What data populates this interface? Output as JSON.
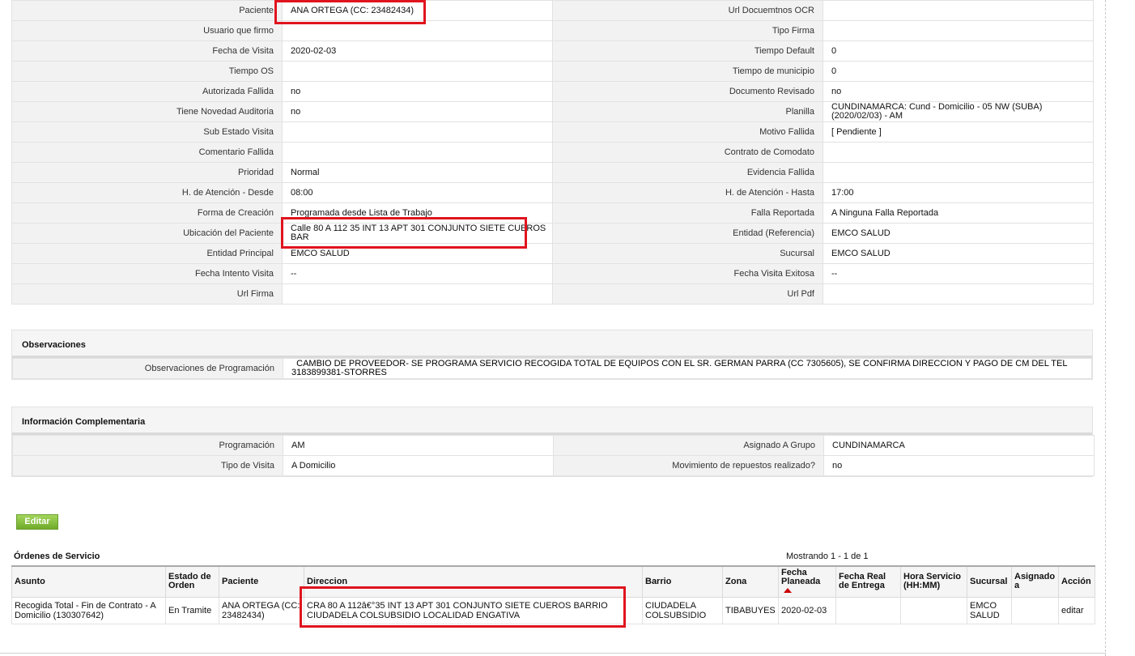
{
  "details": {
    "rows": [
      {
        "l1": "Paciente",
        "v1": "ANA ORTEGA (CC: 23482434)",
        "l2": "Url Docuemtnos OCR",
        "v2": ""
      },
      {
        "l1": "Usuario que firmo",
        "v1": "",
        "l2": "Tipo Firma",
        "v2": ""
      },
      {
        "l1": "Fecha de Visita",
        "v1": "2020-02-03",
        "l2": "Tiempo Default",
        "v2": "0"
      },
      {
        "l1": "Tiempo OS",
        "v1": "",
        "l2": "Tiempo de municipio",
        "v2": "0"
      },
      {
        "l1": "Autorizada Fallida",
        "v1": "no",
        "l2": "Documento Revisado",
        "v2": "no"
      },
      {
        "l1": "Tiene Novedad Auditoria",
        "v1": "no",
        "l2": "Planilla",
        "v2": "CUNDINAMARCA: Cund - Domicilio - 05 NW (SUBA) (2020/02/03) - AM"
      },
      {
        "l1": "Sub Estado Visita",
        "v1": "",
        "l2": "Motivo Fallida",
        "v2": "[ Pendiente ]"
      },
      {
        "l1": "Comentario Fallida",
        "v1": "",
        "l2": "Contrato de Comodato",
        "v2": ""
      },
      {
        "l1": "Prioridad",
        "v1": "Normal",
        "l2": "Evidencia Fallida",
        "v2": ""
      },
      {
        "l1": "H. de Atención - Desde",
        "v1": "08:00",
        "l2": "H. de Atención - Hasta",
        "v2": "17:00"
      },
      {
        "l1": "Forma de Creación",
        "v1": "Programada desde Lista de Trabajo",
        "l2": "Falla Reportada",
        "v2": "A Ninguna Falla Reportada"
      },
      {
        "l1": "Ubicación del Paciente",
        "v1": "Calle 80 A 112 35 INT 13 APT 301 CONJUNTO SIETE CUEROS BAR",
        "l2": "Entidad (Referencia)",
        "v2": "EMCO SALUD"
      },
      {
        "l1": "Entidad Principal",
        "v1": "EMCO SALUD",
        "l2": "Sucursal",
        "v2": "EMCO SALUD"
      },
      {
        "l1": "Fecha Intento Visita",
        "v1": "--",
        "l2": "Fecha Visita Exitosa",
        "v2": "--"
      },
      {
        "l1": "Url Firma",
        "v1": "",
        "l2": "Url Pdf",
        "v2": ""
      }
    ]
  },
  "observaciones": {
    "title": "Observaciones",
    "label": "Observaciones de Programación",
    "value": "  CAMBIO DE PROVEEDOR- SE PROGRAMA SERVICIO RECOGIDA TOTAL DE EQUIPOS CON EL SR. GERMAN PARRA (CC 7305605), SE CONFIRMA DIRECCION Y PAGO DE CM DEL TEL 3183899381-STORRES"
  },
  "complementaria": {
    "title": "Información Complementaria",
    "rows": [
      {
        "l1": "Programación",
        "v1": "AM",
        "l2": "Asignado A Grupo",
        "v2": "CUNDINAMARCA"
      },
      {
        "l1": "Tipo de Visita",
        "v1": "A Domicilio",
        "l2": "Movimiento de repuestos realizado?",
        "v2": "no"
      }
    ]
  },
  "editar_label": "Editar",
  "orders": {
    "title": "Órdenes de Servicio",
    "count_text": "Mostrando 1 - 1 de 1",
    "headers": [
      "Asunto",
      "Estado de Orden",
      "Paciente",
      "Direccion",
      "Barrio",
      "Zona",
      "Fecha Planeada",
      "Fecha Real de Entrega",
      "Hora Servicio (HH:MM)",
      "Sucursal",
      "Asignado a",
      "Acción"
    ],
    "rows": [
      {
        "asunto": "Recogida Total - Fin de Contrato - A Domicilio (130307642)",
        "estado": "En Tramite",
        "paciente": "ANA ORTEGA (CC: 23482434)",
        "direccion": "CRA 80 A 112â€°35 INT 13 APT 301 CONJUNTO SIETE CUEROS BARRIO CIUDADELA COLSUBSIDIO LOCALIDAD ENGATIVA",
        "barrio": "CIUDADELA COLSUBSIDIO",
        "zona": "TIBABUYES",
        "fecha_planeada": "2020-02-03",
        "fecha_real": "",
        "hora": "",
        "sucursal": "EMCO SALUD",
        "asignado": "",
        "accion": "editar"
      }
    ]
  },
  "colors": {
    "highlight": "#e0141e",
    "button": "#7ab834",
    "link": "#1a3f7a"
  }
}
